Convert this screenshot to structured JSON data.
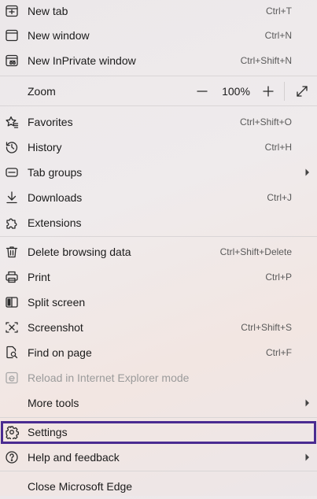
{
  "menu": {
    "new_tab": {
      "label": "New tab",
      "shortcut": "Ctrl+T"
    },
    "new_window": {
      "label": "New window",
      "shortcut": "Ctrl+N"
    },
    "new_inprivate": {
      "label": "New InPrivate window",
      "shortcut": "Ctrl+Shift+N"
    },
    "zoom": {
      "label": "Zoom",
      "value": "100%"
    },
    "favorites": {
      "label": "Favorites",
      "shortcut": "Ctrl+Shift+O"
    },
    "history": {
      "label": "History",
      "shortcut": "Ctrl+H"
    },
    "tab_groups": {
      "label": "Tab groups"
    },
    "downloads": {
      "label": "Downloads",
      "shortcut": "Ctrl+J"
    },
    "extensions": {
      "label": "Extensions"
    },
    "delete_browsing": {
      "label": "Delete browsing data",
      "shortcut": "Ctrl+Shift+Delete"
    },
    "print": {
      "label": "Print",
      "shortcut": "Ctrl+P"
    },
    "split_screen": {
      "label": "Split screen"
    },
    "screenshot": {
      "label": "Screenshot",
      "shortcut": "Ctrl+Shift+S"
    },
    "find_on_page": {
      "label": "Find on page",
      "shortcut": "Ctrl+F"
    },
    "reload_ie": {
      "label": "Reload in Internet Explorer mode"
    },
    "more_tools": {
      "label": "More tools"
    },
    "settings": {
      "label": "Settings"
    },
    "help": {
      "label": "Help and feedback"
    },
    "close_edge": {
      "label": "Close Microsoft Edge"
    }
  },
  "colors": {
    "highlight_border": "#4a2b91",
    "disabled_text": "#9b9b9b"
  }
}
